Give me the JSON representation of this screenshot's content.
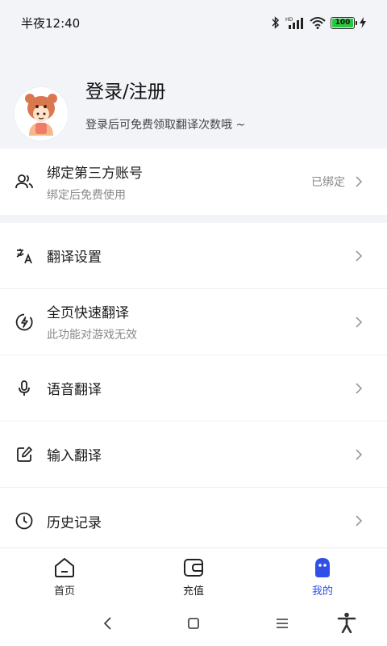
{
  "status": {
    "time": "半夜12:40",
    "battery": "100"
  },
  "profile": {
    "title": "登录/注册",
    "subtitle": "登录后可免费领取翻译次数哦 ~"
  },
  "bind": {
    "title": "绑定第三方账号",
    "subtitle": "绑定后免费使用",
    "status": "已绑定"
  },
  "menu": {
    "items": [
      {
        "title": "翻译设置",
        "subtitle": ""
      },
      {
        "title": "全页快速翻译",
        "subtitle": "此功能对游戏无效"
      },
      {
        "title": "语音翻译",
        "subtitle": ""
      },
      {
        "title": "输入翻译",
        "subtitle": ""
      },
      {
        "title": "历史记录",
        "subtitle": ""
      }
    ]
  },
  "tabs": [
    {
      "label": "首页",
      "icon": "home-icon"
    },
    {
      "label": "充值",
      "icon": "wallet-icon"
    },
    {
      "label": "我的",
      "icon": "user-icon"
    }
  ],
  "colors": {
    "accent": "#2f4fe8",
    "background": "#f3f4f8",
    "battery": "#27c93f"
  }
}
